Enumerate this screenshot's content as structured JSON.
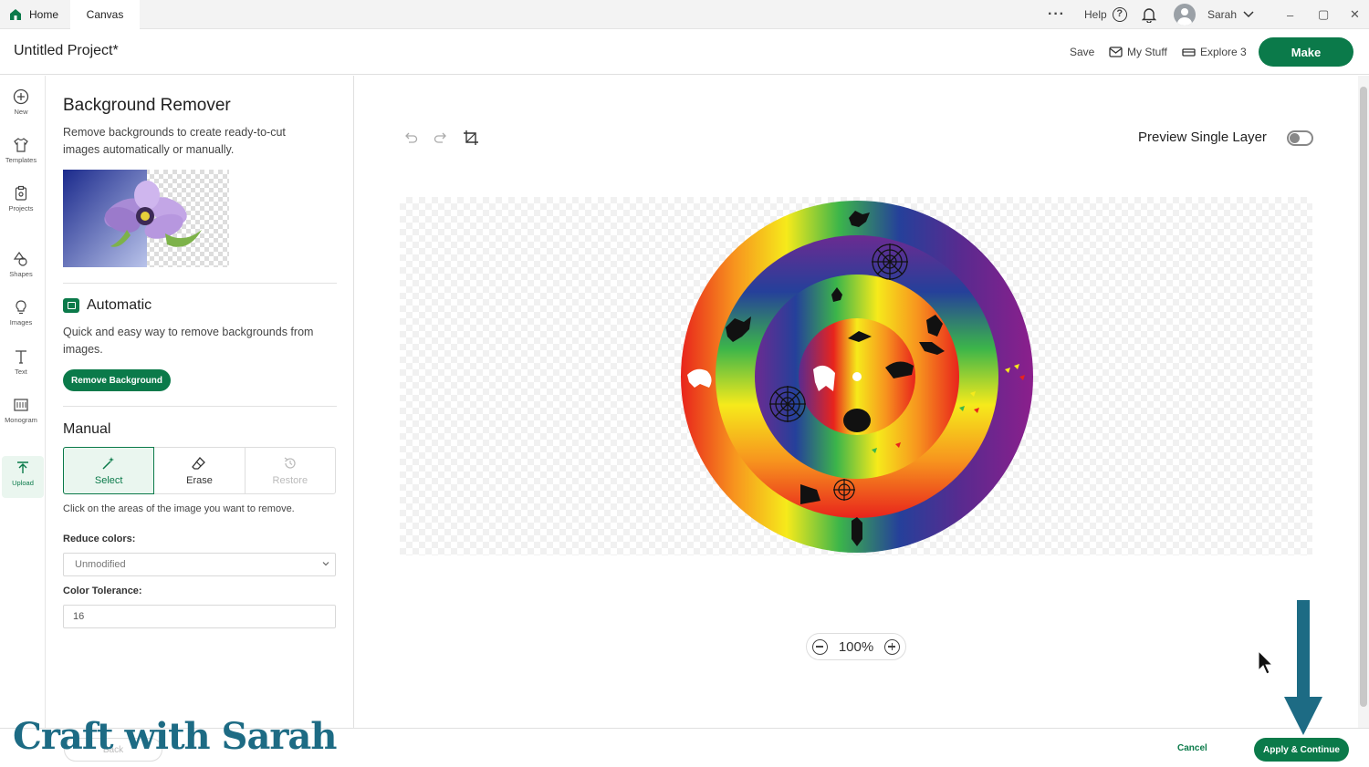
{
  "titlebar": {
    "tabs": [
      {
        "label": "Home"
      },
      {
        "label": "Canvas"
      }
    ],
    "more_label": "···",
    "help_label": "Help",
    "help_glyph": "?",
    "user_name": "Sarah",
    "window_controls": [
      "–",
      "▢",
      "✕"
    ]
  },
  "header": {
    "project_title": "Untitled Project*",
    "save_label": "Save",
    "my_stuff_label": "My Stuff",
    "machine_label": "Explore 3",
    "make_label": "Make"
  },
  "rail": {
    "items": [
      {
        "label": "New",
        "icon": "plus-circle-icon"
      },
      {
        "label": "Templates",
        "icon": "shirt-icon"
      },
      {
        "label": "Projects",
        "icon": "clipboard-icon"
      },
      {
        "label": "Shapes",
        "icon": "shapes-icon"
      },
      {
        "label": "Images",
        "icon": "lightbulb-icon"
      },
      {
        "label": "Text",
        "icon": "text-icon"
      },
      {
        "label": "Monogram",
        "icon": "monogram-icon"
      },
      {
        "label": "Upload",
        "icon": "upload-icon",
        "active": true
      }
    ]
  },
  "panel": {
    "title": "Background Remover",
    "description": "Remove backgrounds to create ready-to-cut images automatically or manually.",
    "automatic": {
      "title": "Automatic",
      "description": "Quick and easy way to remove backgrounds from images.",
      "button_label": "Remove Background"
    },
    "manual": {
      "title": "Manual",
      "tools": [
        {
          "label": "Select",
          "icon": "magic-wand-icon",
          "selected": true
        },
        {
          "label": "Erase",
          "icon": "eraser-icon"
        },
        {
          "label": "Restore",
          "icon": "restore-icon",
          "disabled": true
        }
      ],
      "hint": "Click on the areas of the image you want to remove.",
      "reduce_colors_label": "Reduce colors:",
      "reduce_colors_value": "Unmodified",
      "tolerance_label": "Color Tolerance:",
      "tolerance_value": "16"
    }
  },
  "canvas": {
    "preview_label": "Preview Single Layer",
    "preview_enabled": false,
    "zoom_value": "100%"
  },
  "footer": {
    "back_label": "Back",
    "cancel_label": "Cancel",
    "apply_label": "Apply & Continue"
  },
  "watermark": "Craft with Sarah",
  "colors": {
    "brand": "#0b7a4a",
    "annotation": "#1d6b84"
  }
}
